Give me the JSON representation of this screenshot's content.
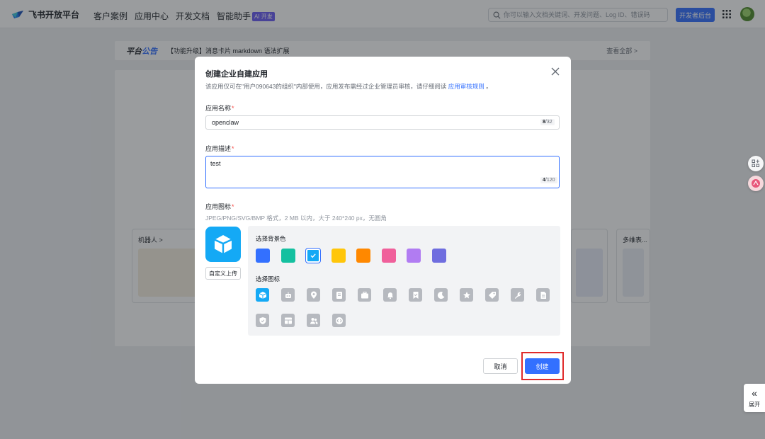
{
  "nav": {
    "brand": "飞书开放平台",
    "items": [
      "客户案例",
      "应用中心",
      "开发文档",
      "智能助手"
    ],
    "ai_badge": "AI 开发",
    "search_placeholder": "你可以输入文档关键词、开发问题、Log ID、错误码",
    "dev_console": "开发者后台"
  },
  "announcement": {
    "title_a": "平台",
    "title_b": "公告",
    "text": "【功能升级】消息卡片 markdown 语法扩展",
    "more": "查看全部 >"
  },
  "background": {
    "card_robot": "机器人 >",
    "card_more": "多维表..."
  },
  "side": {
    "expand": "展开"
  },
  "modal": {
    "title": "创建企业自建应用",
    "desc": "该应用仅可在\"用户090643的组织\"内部使用，应用发布需经过企业管理员审核，请仔细阅读",
    "desc_link": "应用审核规则",
    "desc_end": "。",
    "name_label": "应用名称",
    "name_value": "openclaw",
    "name_count": "8",
    "name_max": "/32",
    "desc_label": "应用描述",
    "desc_value": "test",
    "desc_count": "4",
    "desc_max": "/120",
    "icon_label": "应用图标",
    "icon_hint": "JPEG/PNG/SVG/BMP 格式，2 MB 以内，大于 240*240 px，无圆角",
    "upload": "自定义上传",
    "bg_color_label": "选择背景色",
    "icon_choose_label": "选择图标",
    "colors": [
      "#3370ff",
      "#14c0a0",
      "#14a9f5",
      "#ffc60a",
      "#ff8800",
      "#f0609b",
      "#b17cf2",
      "#6f6ddf"
    ],
    "selected_color": 2,
    "icons": [
      "box-icon",
      "robot-icon",
      "location-pin-icon",
      "document-icon",
      "briefcase-icon",
      "bell-icon",
      "bookmark-check-icon",
      "moon-icon",
      "star-icon",
      "tag-icon",
      "wrench-icon",
      "file-text-icon",
      "shield-check-icon",
      "layout-icon",
      "users-icon",
      "code-icon"
    ],
    "selected_icon": 0,
    "cancel": "取消",
    "create": "创建"
  }
}
